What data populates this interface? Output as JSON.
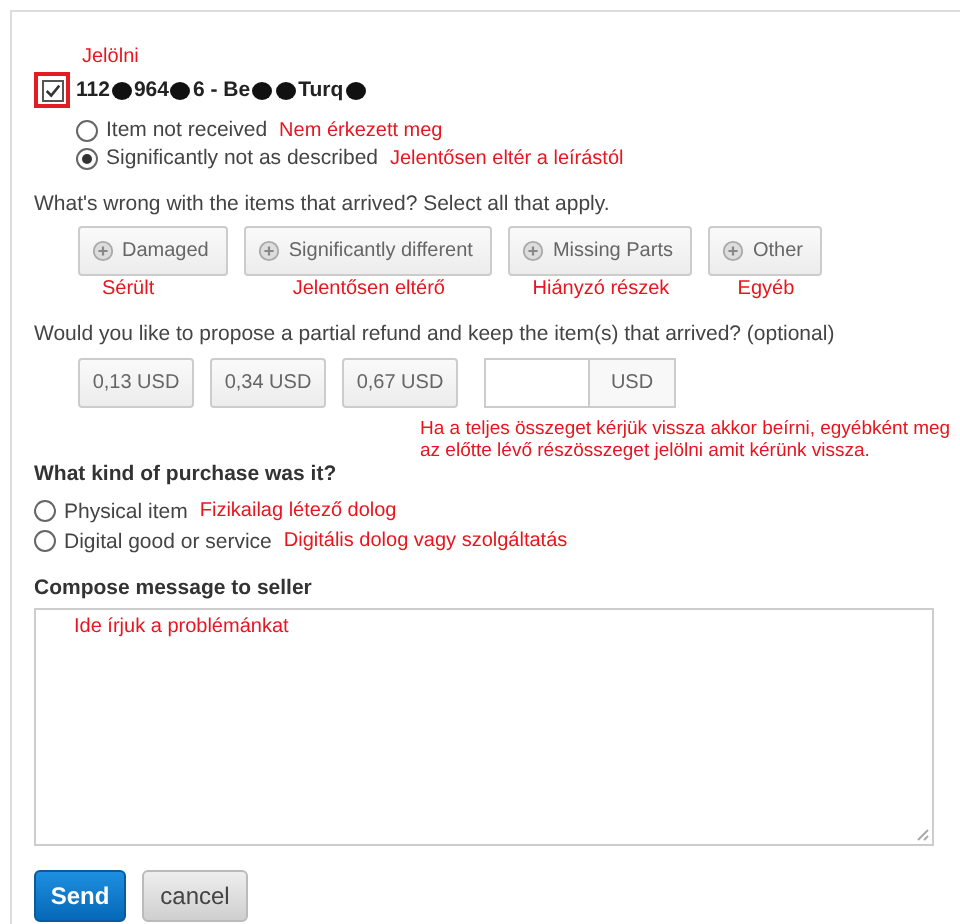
{
  "item": {
    "annotation": "Jelölni",
    "checked": true,
    "title_parts": [
      {
        "kind": "text",
        "text": "112"
      },
      {
        "kind": "redacted"
      },
      {
        "kind": "text",
        "text": "964"
      },
      {
        "kind": "redacted"
      },
      {
        "kind": "text",
        "text": "6 - Be"
      },
      {
        "kind": "redacted"
      },
      {
        "kind": "redacted"
      },
      {
        "kind": "text",
        "text": "Turq"
      },
      {
        "kind": "redacted"
      }
    ]
  },
  "issue_options": [
    {
      "label": "Item not received",
      "selected": false,
      "annotation": "Nem érkezett meg"
    },
    {
      "label": "Significantly not as described",
      "selected": true,
      "annotation": "Jelentősen eltér a leírástól"
    }
  ],
  "problems": {
    "question": "What's wrong with the items that arrived? Select all that apply.",
    "options": [
      {
        "label": "Damaged",
        "selected": false,
        "annotation": "Sérült"
      },
      {
        "label": "Significantly different",
        "selected": false,
        "annotation": "Jelentősen eltérő"
      },
      {
        "label": "Missing Parts",
        "selected": false,
        "annotation": "Hiányzó részek"
      },
      {
        "label": "Other",
        "selected": false,
        "annotation": "Egyéb"
      }
    ]
  },
  "refund": {
    "question": "Would you like to propose a partial refund and keep the item(s) that arrived? (optional)",
    "amounts": [
      {
        "label": "0,13 USD",
        "selected": false
      },
      {
        "label": "0,34 USD",
        "selected": false
      },
      {
        "label": "0,67 USD",
        "selected": false
      }
    ],
    "custom_currency": "USD",
    "annotation": "Ha a teljes összeget kérjük vissza akkor beírni, egyébként meg az előtte lévő részösszeget jelölni amit kérünk vissza."
  },
  "purchase": {
    "question": "What kind of purchase was it?",
    "options": [
      {
        "label": "Physical item",
        "selected": false,
        "annotation": "Fizikailag létező dolog"
      },
      {
        "label": "Digital good or service",
        "selected": false,
        "annotation": "Digitális dolog vagy szolgáltatás"
      }
    ]
  },
  "message": {
    "heading": "Compose message to seller",
    "annotation": "Ide írjuk a problémánkat"
  },
  "buttons": [
    {
      "label": "Send",
      "kind": "primary"
    },
    {
      "label": "cancel",
      "kind": "secondary"
    }
  ]
}
